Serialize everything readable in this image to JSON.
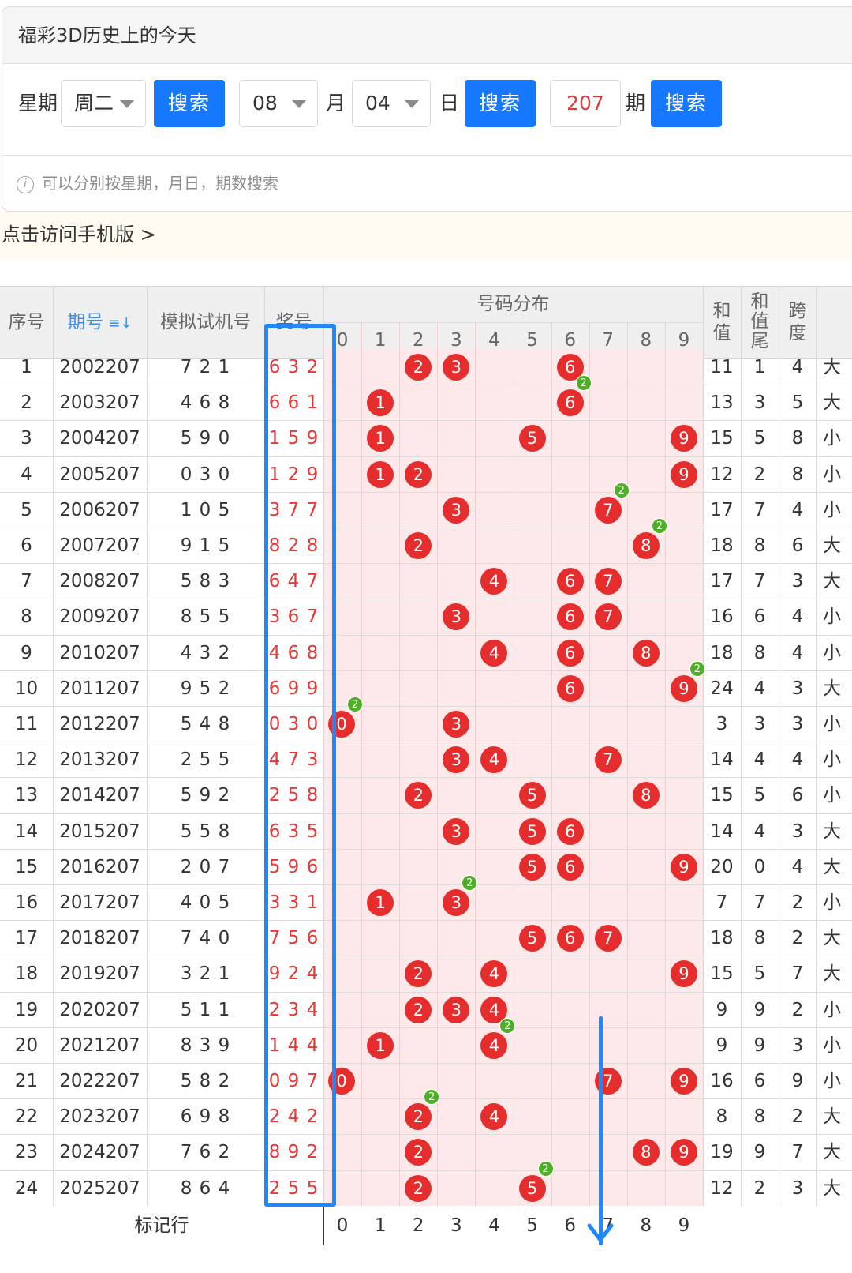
{
  "panel": {
    "title": "福彩3D历史上的今天",
    "weekday_label": "星期",
    "weekday_value": "周二",
    "search_label": "搜索",
    "month_value": "08",
    "month_label": "月",
    "day_value": "04",
    "day_label": "日",
    "issue_value": "207",
    "issue_label": "期",
    "hint": "可以分别按星期，月日，期数搜索",
    "hint_icon": "i"
  },
  "notice": "点击访问手机版 >",
  "table": {
    "headers": {
      "index": "序号",
      "issue": "期号",
      "sort_icon": "≡↓",
      "trial": "模拟试机号",
      "award": "奖号",
      "distribution": "号码分布",
      "sum_top": "和",
      "sum_bottom": "值",
      "tail_1": "和",
      "tail_2": "值",
      "tail_3": "尾",
      "span_top": "跨",
      "span_bottom": "度"
    },
    "digits": [
      "0",
      "1",
      "2",
      "3",
      "4",
      "5",
      "6",
      "7",
      "8",
      "9"
    ],
    "footer_label": "标记行",
    "rows": [
      {
        "idx": "1",
        "issue": "2002207",
        "trial": "7 2 1",
        "award": "6 3 2",
        "sum": "11",
        "tail": "1",
        "span": "4",
        "edge": "大",
        "balls": [
          2,
          3,
          6
        ],
        "badge": null
      },
      {
        "idx": "2",
        "issue": "2003207",
        "trial": "4 6 8",
        "award": "6 6 1",
        "sum": "13",
        "tail": "3",
        "span": "5",
        "edge": "大",
        "balls": [
          1,
          6
        ],
        "badge": 6
      },
      {
        "idx": "3",
        "issue": "2004207",
        "trial": "5 9 0",
        "award": "1 5 9",
        "sum": "15",
        "tail": "5",
        "span": "8",
        "edge": "小",
        "balls": [
          1,
          5,
          9
        ],
        "badge": null
      },
      {
        "idx": "4",
        "issue": "2005207",
        "trial": "0 3 0",
        "award": "1 2 9",
        "sum": "12",
        "tail": "2",
        "span": "8",
        "edge": "小",
        "balls": [
          1,
          2,
          9
        ],
        "badge": null
      },
      {
        "idx": "5",
        "issue": "2006207",
        "trial": "1 0 5",
        "award": "3 7 7",
        "sum": "17",
        "tail": "7",
        "span": "4",
        "edge": "小",
        "balls": [
          3,
          7
        ],
        "badge": 7
      },
      {
        "idx": "6",
        "issue": "2007207",
        "trial": "9 1 5",
        "award": "8 2 8",
        "sum": "18",
        "tail": "8",
        "span": "6",
        "edge": "大",
        "balls": [
          2,
          8
        ],
        "badge": 8
      },
      {
        "idx": "7",
        "issue": "2008207",
        "trial": "5 8 3",
        "award": "6 4 7",
        "sum": "17",
        "tail": "7",
        "span": "3",
        "edge": "大",
        "balls": [
          4,
          6,
          7
        ],
        "badge": null
      },
      {
        "idx": "8",
        "issue": "2009207",
        "trial": "8 5 5",
        "award": "3 6 7",
        "sum": "16",
        "tail": "6",
        "span": "4",
        "edge": "小",
        "balls": [
          3,
          6,
          7
        ],
        "badge": null
      },
      {
        "idx": "9",
        "issue": "2010207",
        "trial": "4 3 2",
        "award": "4 6 8",
        "sum": "18",
        "tail": "8",
        "span": "4",
        "edge": "小",
        "balls": [
          4,
          6,
          8
        ],
        "badge": null
      },
      {
        "idx": "10",
        "issue": "2011207",
        "trial": "9 5 2",
        "award": "6 9 9",
        "sum": "24",
        "tail": "4",
        "span": "3",
        "edge": "大",
        "balls": [
          6,
          9
        ],
        "badge": 9
      },
      {
        "idx": "11",
        "issue": "2012207",
        "trial": "5 4 8",
        "award": "0 3 0",
        "sum": "3",
        "tail": "3",
        "span": "3",
        "edge": "小",
        "balls": [
          0,
          3
        ],
        "badge": 0
      },
      {
        "idx": "12",
        "issue": "2013207",
        "trial": "2 5 5",
        "award": "4 7 3",
        "sum": "14",
        "tail": "4",
        "span": "4",
        "edge": "小",
        "balls": [
          3,
          4,
          7
        ],
        "badge": null
      },
      {
        "idx": "13",
        "issue": "2014207",
        "trial": "5 9 2",
        "award": "2 5 8",
        "sum": "15",
        "tail": "5",
        "span": "6",
        "edge": "小",
        "balls": [
          2,
          5,
          8
        ],
        "badge": null
      },
      {
        "idx": "14",
        "issue": "2015207",
        "trial": "5 5 8",
        "award": "6 3 5",
        "sum": "14",
        "tail": "4",
        "span": "3",
        "edge": "大",
        "balls": [
          3,
          5,
          6
        ],
        "badge": null
      },
      {
        "idx": "15",
        "issue": "2016207",
        "trial": "2 0 7",
        "award": "5 9 6",
        "sum": "20",
        "tail": "0",
        "span": "4",
        "edge": "大",
        "balls": [
          5,
          6,
          9
        ],
        "badge": null
      },
      {
        "idx": "16",
        "issue": "2017207",
        "trial": "4 0 5",
        "award": "3 3 1",
        "sum": "7",
        "tail": "7",
        "span": "2",
        "edge": "小",
        "balls": [
          1,
          3
        ],
        "badge": 3
      },
      {
        "idx": "17",
        "issue": "2018207",
        "trial": "7 4 0",
        "award": "7 5 6",
        "sum": "18",
        "tail": "8",
        "span": "2",
        "edge": "大",
        "balls": [
          5,
          6,
          7
        ],
        "badge": null
      },
      {
        "idx": "18",
        "issue": "2019207",
        "trial": "3 2 1",
        "award": "9 2 4",
        "sum": "15",
        "tail": "5",
        "span": "7",
        "edge": "大",
        "balls": [
          2,
          4,
          9
        ],
        "badge": null
      },
      {
        "idx": "19",
        "issue": "2020207",
        "trial": "5 1 1",
        "award": "2 3 4",
        "sum": "9",
        "tail": "9",
        "span": "2",
        "edge": "小",
        "balls": [
          2,
          3,
          4
        ],
        "badge": null
      },
      {
        "idx": "20",
        "issue": "2021207",
        "trial": "8 3 9",
        "award": "1 4 4",
        "sum": "9",
        "tail": "9",
        "span": "3",
        "edge": "小",
        "balls": [
          1,
          4
        ],
        "badge": 4
      },
      {
        "idx": "21",
        "issue": "2022207",
        "trial": "5 8 2",
        "award": "0 9 7",
        "sum": "16",
        "tail": "6",
        "span": "9",
        "edge": "小",
        "balls": [
          0,
          7,
          9
        ],
        "badge": null
      },
      {
        "idx": "22",
        "issue": "2023207",
        "trial": "6 9 8",
        "award": "2 4 2",
        "sum": "8",
        "tail": "8",
        "span": "2",
        "edge": "大",
        "balls": [
          2,
          4
        ],
        "badge": 2
      },
      {
        "idx": "23",
        "issue": "2024207",
        "trial": "7 6 2",
        "award": "8 9 2",
        "sum": "19",
        "tail": "9",
        "span": "7",
        "edge": "大",
        "balls": [
          2,
          8,
          9
        ],
        "badge": null
      },
      {
        "idx": "24",
        "issue": "2025207",
        "trial": "8 6 4",
        "award": "2 5 5",
        "sum": "12",
        "tail": "2",
        "span": "3",
        "edge": "大",
        "balls": [
          2,
          5
        ],
        "badge": 5
      }
    ],
    "badge_text": "2"
  },
  "colors": {
    "accent": "#1677ff",
    "ball": "#e62d2d",
    "badge": "#4caf26",
    "award_text": "#e53935",
    "annotation": "#1e88ff"
  }
}
